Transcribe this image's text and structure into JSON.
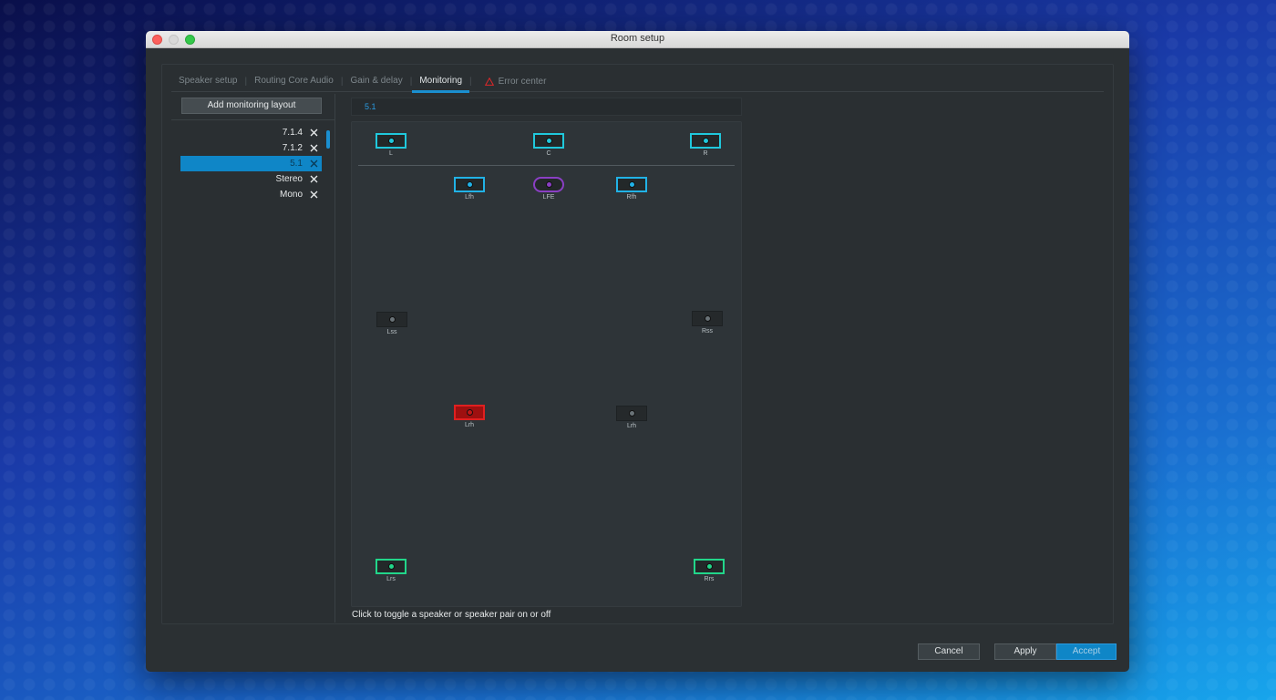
{
  "window": {
    "title": "Room setup"
  },
  "tabs": [
    {
      "label": "Speaker setup",
      "active": false
    },
    {
      "label": "Routing Core Audio",
      "active": false
    },
    {
      "label": "Gain & delay",
      "active": false
    },
    {
      "label": "Monitoring",
      "active": true
    }
  ],
  "error_tab": {
    "label": "Error center",
    "icon": "warning-triangle-icon",
    "color": "#e0282a"
  },
  "sidebar": {
    "add_button": "Add monitoring layout",
    "layouts": [
      {
        "label": "7.1.4",
        "selected": false
      },
      {
        "label": "7.1.2",
        "selected": false
      },
      {
        "label": "5.1",
        "selected": true
      },
      {
        "label": "Stereo",
        "selected": false
      },
      {
        "label": "Mono",
        "selected": false
      }
    ]
  },
  "layout_name": "5.1",
  "speakers": [
    {
      "label": "L",
      "state": "on-cyan"
    },
    {
      "label": "C",
      "state": "on-cyan"
    },
    {
      "label": "R",
      "state": "on-cyan"
    },
    {
      "label": "Lfh",
      "state": "on-blue"
    },
    {
      "label": "LFE",
      "state": "lfe-purple"
    },
    {
      "label": "Rfh",
      "state": "on-blue"
    },
    {
      "label": "Lss",
      "state": "off"
    },
    {
      "label": "Rss",
      "state": "off"
    },
    {
      "label": "Lrh",
      "state": "error-red"
    },
    {
      "label": "Lrh",
      "state": "off"
    },
    {
      "label": "Lrs",
      "state": "on-green"
    },
    {
      "label": "Rrs",
      "state": "on-green"
    }
  ],
  "hint": "Click to toggle a speaker or speaker pair on or off",
  "buttons": {
    "cancel": "Cancel",
    "apply": "Apply",
    "accept": "Accept"
  },
  "colors": {
    "accent": "#0f86c7",
    "speaker_cyan": "#20c8dc",
    "speaker_blue": "#21b2e6",
    "speaker_green": "#22d68a",
    "speaker_purple": "#8a3fc4",
    "speaker_error": "#e02020"
  }
}
